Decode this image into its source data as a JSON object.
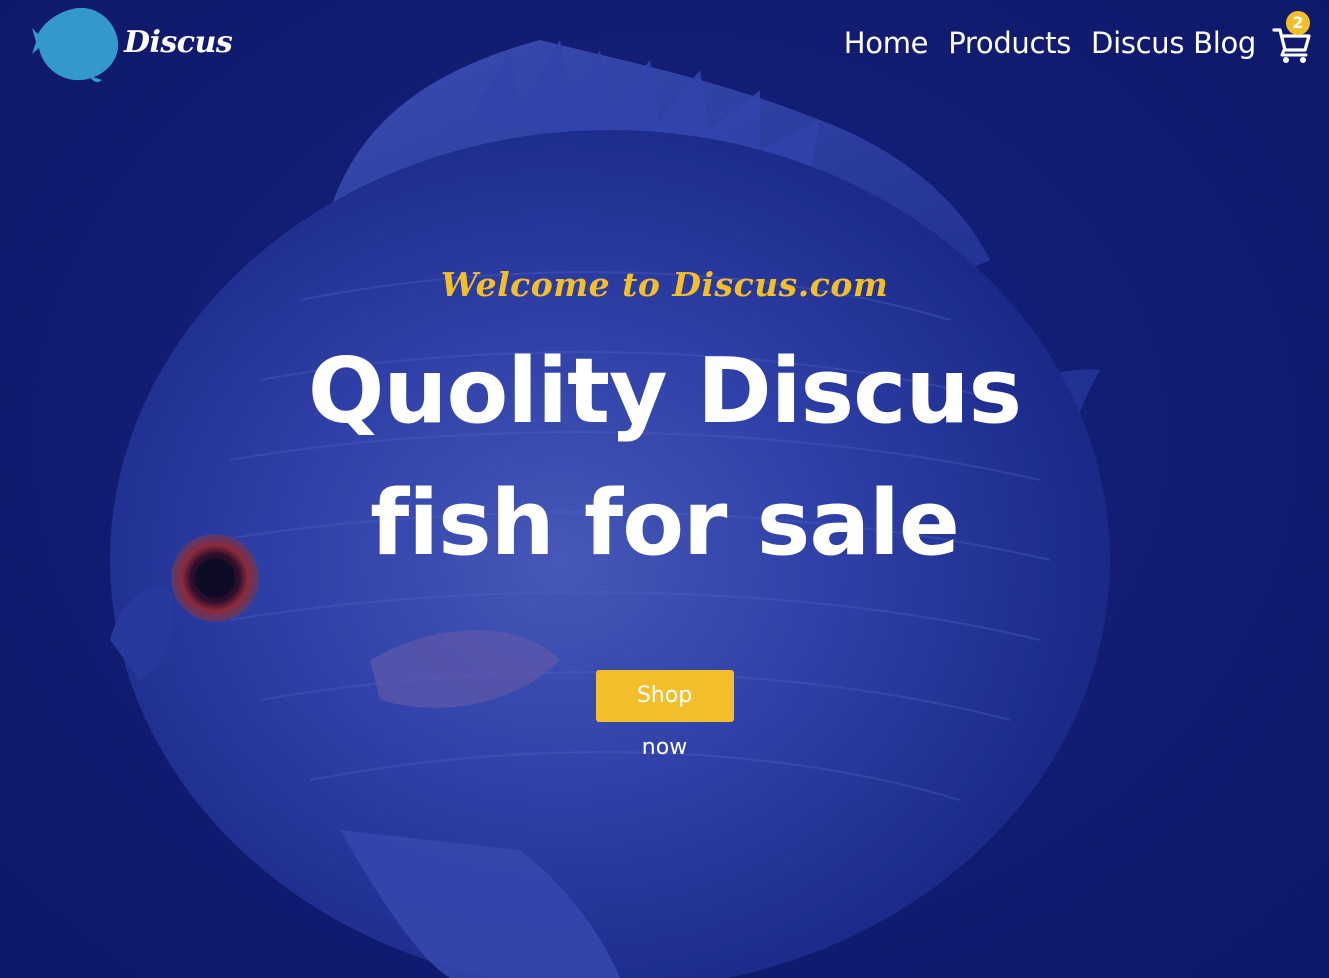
{
  "brand": {
    "name": "Discus",
    "logo_icon": "discus-fish-icon"
  },
  "nav": {
    "items": [
      {
        "label": "Home"
      },
      {
        "label": "Products"
      },
      {
        "label": "Discus Blog"
      }
    ],
    "cart": {
      "icon": "cart-icon",
      "count": "2"
    }
  },
  "hero": {
    "welcome": "Welcome to Discus.com",
    "headline_line1": "Quolity Discus",
    "headline_line2": "fish for sale",
    "cta_label": "Shop now",
    "background": "discus-fish-photo"
  },
  "colors": {
    "background": "#14207a",
    "accent": "#f2bf2b",
    "logo_fish": "#3399cc",
    "text": "#ffffff"
  }
}
